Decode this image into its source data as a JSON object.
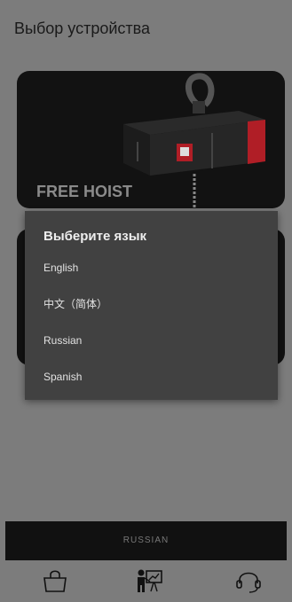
{
  "header": {
    "title": "Выбор устройства"
  },
  "devices": [
    {
      "label": "FREE HOIST"
    },
    {
      "label": ""
    }
  ],
  "language_dialog": {
    "title": "Выберите язык",
    "options": [
      "English",
      "中文（简体）",
      "Russian",
      "Spanish"
    ]
  },
  "bottom_bar": {
    "language_label": "RUSSIAN"
  },
  "nav": [
    {
      "icon": "shopping-bag-icon"
    },
    {
      "icon": "presentation-icon"
    },
    {
      "icon": "headset-icon"
    }
  ],
  "colors": {
    "overlay": "#7c7c7c",
    "card": "#121212",
    "dialog": "#414141",
    "accent_red": "#c0202a"
  }
}
